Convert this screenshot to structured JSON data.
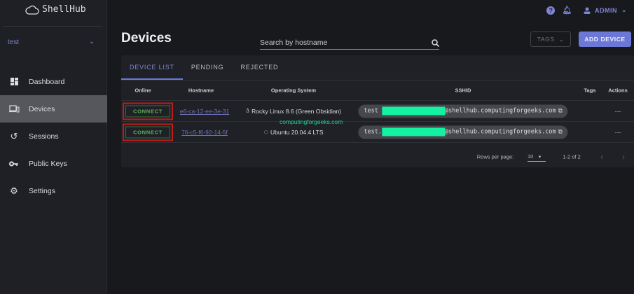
{
  "app": {
    "logo": "ShellHub"
  },
  "sidebar": {
    "namespace": "test",
    "items": [
      {
        "label": "Dashboard"
      },
      {
        "label": "Devices"
      },
      {
        "label": "Sessions"
      },
      {
        "label": "Public Keys"
      },
      {
        "label": "Settings"
      }
    ]
  },
  "header": {
    "user": "ADMIN"
  },
  "page": {
    "title": "Devices",
    "search_placeholder": "Search by hostname",
    "tags_label": "TAGS",
    "add_device_label": "ADD DEVICE"
  },
  "tabs": [
    {
      "label": "DEVICE LIST"
    },
    {
      "label": "PENDING"
    },
    {
      "label": "REJECTED"
    }
  ],
  "table": {
    "headers": [
      "Online",
      "Hostname",
      "Operating System",
      "SSHID",
      "Tags",
      "Actions"
    ],
    "rows": [
      {
        "connect": "CONNECT",
        "hostname": "e6-ca-12-ee-3e-31",
        "os": "Rocky Linux 8.6 (Green Obsidian)",
        "ssh_prefix": "test",
        "ssh_suffix": "@shellhub.computingforgeeks.com",
        "actions": "···"
      },
      {
        "connect": "CONNECT",
        "hostname": "76-c5-f6-92-14-5f",
        "os": "Ubuntu 20.04.4 LTS",
        "ssh_prefix": "test.",
        "ssh_suffix": "@shellhub.computingforgeeks.com",
        "actions": "···"
      }
    ]
  },
  "watermark": "computingforgeeks.com",
  "pagination": {
    "rows_label": "Rows per page:",
    "rows_value": "10",
    "range": "1-2 of 2"
  },
  "colors": {
    "accent": "#6c78d6",
    "connect": "#59b35c",
    "mask": "#13f2a0"
  }
}
